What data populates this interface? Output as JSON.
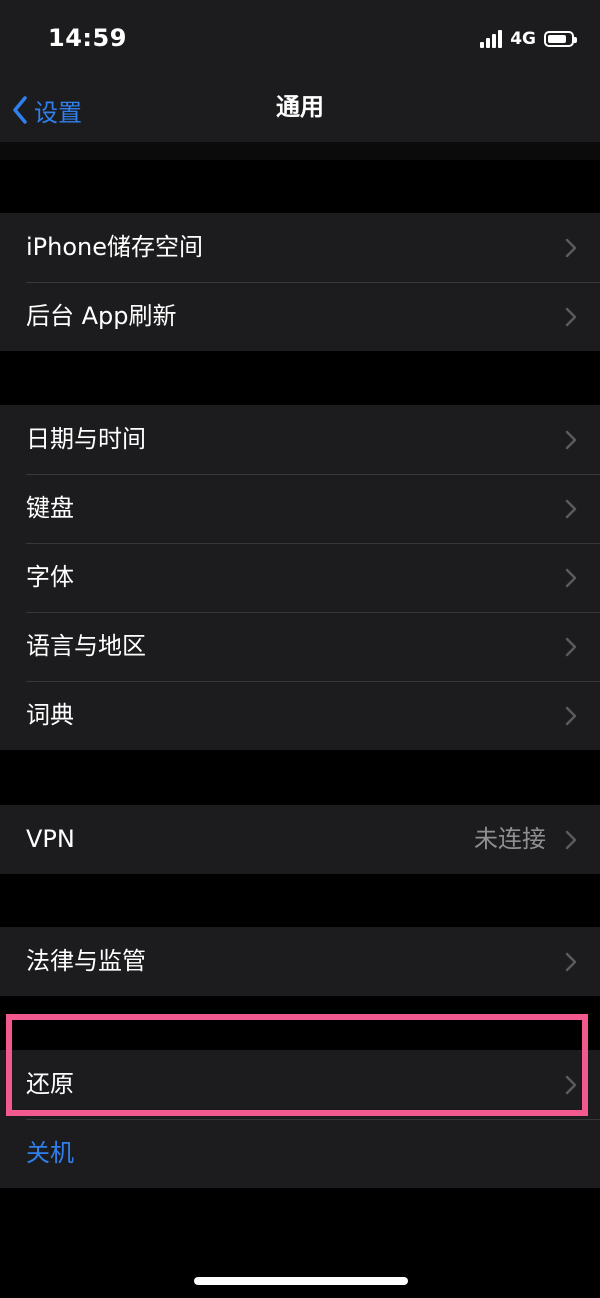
{
  "status_bar": {
    "time": "14:59",
    "network": "4G",
    "battery_level": 0.8,
    "icons": [
      "signal-icon",
      "battery-icon"
    ]
  },
  "nav": {
    "back_label": "设置",
    "title": "通用",
    "back_icon": "chevron-left-icon"
  },
  "groups": [
    {
      "rows": [
        {
          "label": "iPhone储存空间",
          "value": ""
        },
        {
          "label": "后台 App刷新",
          "value": ""
        }
      ]
    },
    {
      "rows": [
        {
          "label": "日期与时间",
          "value": ""
        },
        {
          "label": "键盘",
          "value": ""
        },
        {
          "label": "字体",
          "value": ""
        },
        {
          "label": "语言与地区",
          "value": ""
        },
        {
          "label": "词典",
          "value": ""
        }
      ]
    },
    {
      "rows": [
        {
          "label": "VPN",
          "value": "未连接"
        }
      ]
    },
    {
      "rows": [
        {
          "label": "法律与监管",
          "value": ""
        }
      ]
    },
    {
      "rows": [
        {
          "label": "还原",
          "value": ""
        },
        {
          "label": "关机",
          "value": ""
        }
      ]
    }
  ],
  "colors": {
    "accent": "#2f80ed",
    "highlight": "#f25a8f",
    "cell_background": "#1c1c1e",
    "page_background": "#000000"
  }
}
